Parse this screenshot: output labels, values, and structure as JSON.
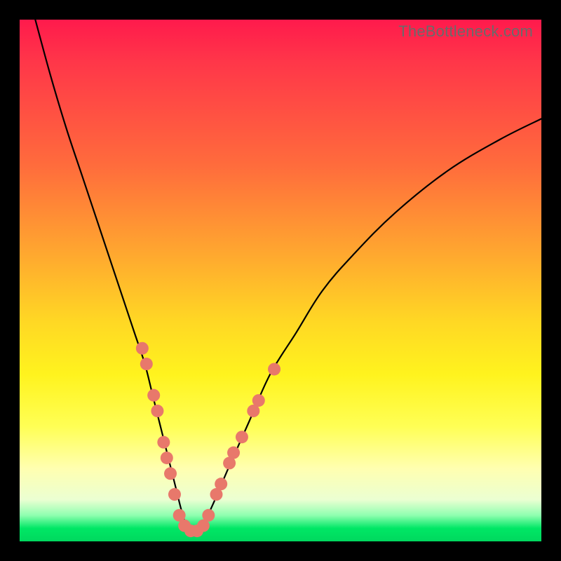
{
  "watermark": "TheBottleneck.com",
  "colors": {
    "bead": "#e8786b",
    "line": "#000000",
    "frame": "#000000"
  },
  "chart_data": {
    "type": "line",
    "title": "",
    "xlabel": "",
    "ylabel": "",
    "xlim": [
      0,
      100
    ],
    "ylim": [
      0,
      100
    ],
    "grid": false,
    "legend": false,
    "series": [
      {
        "name": "bottleneck-curve",
        "x": [
          3,
          6,
          9,
          12,
          15,
          18,
          20,
          22,
          24,
          25.5,
          27,
          28.5,
          30,
          31,
          32,
          33.5,
          35,
          37,
          40,
          44,
          48,
          53,
          58,
          64,
          72,
          82,
          92,
          100
        ],
        "y": [
          100,
          89,
          79,
          70,
          61,
          52,
          46,
          40,
          34,
          28,
          22,
          16,
          10,
          6,
          3,
          2,
          3,
          7,
          14,
          23,
          32,
          40,
          48,
          55,
          63,
          71,
          77,
          81
        ]
      }
    ],
    "beads": {
      "name": "highlight-points",
      "note": "Salmon dots emphasizing points on the lower V of the curve",
      "points": [
        {
          "x": 23.5,
          "y": 37
        },
        {
          "x": 24.3,
          "y": 34
        },
        {
          "x": 25.7,
          "y": 28
        },
        {
          "x": 26.4,
          "y": 25
        },
        {
          "x": 27.6,
          "y": 19
        },
        {
          "x": 28.2,
          "y": 16
        },
        {
          "x": 28.9,
          "y": 13
        },
        {
          "x": 29.7,
          "y": 9
        },
        {
          "x": 30.6,
          "y": 5
        },
        {
          "x": 31.6,
          "y": 3
        },
        {
          "x": 32.8,
          "y": 2
        },
        {
          "x": 34.0,
          "y": 2
        },
        {
          "x": 35.2,
          "y": 3
        },
        {
          "x": 36.2,
          "y": 5
        },
        {
          "x": 37.7,
          "y": 9
        },
        {
          "x": 38.6,
          "y": 11
        },
        {
          "x": 40.2,
          "y": 15
        },
        {
          "x": 41.0,
          "y": 17
        },
        {
          "x": 42.6,
          "y": 20
        },
        {
          "x": 44.8,
          "y": 25
        },
        {
          "x": 45.8,
          "y": 27
        },
        {
          "x": 48.8,
          "y": 33
        }
      ]
    }
  }
}
